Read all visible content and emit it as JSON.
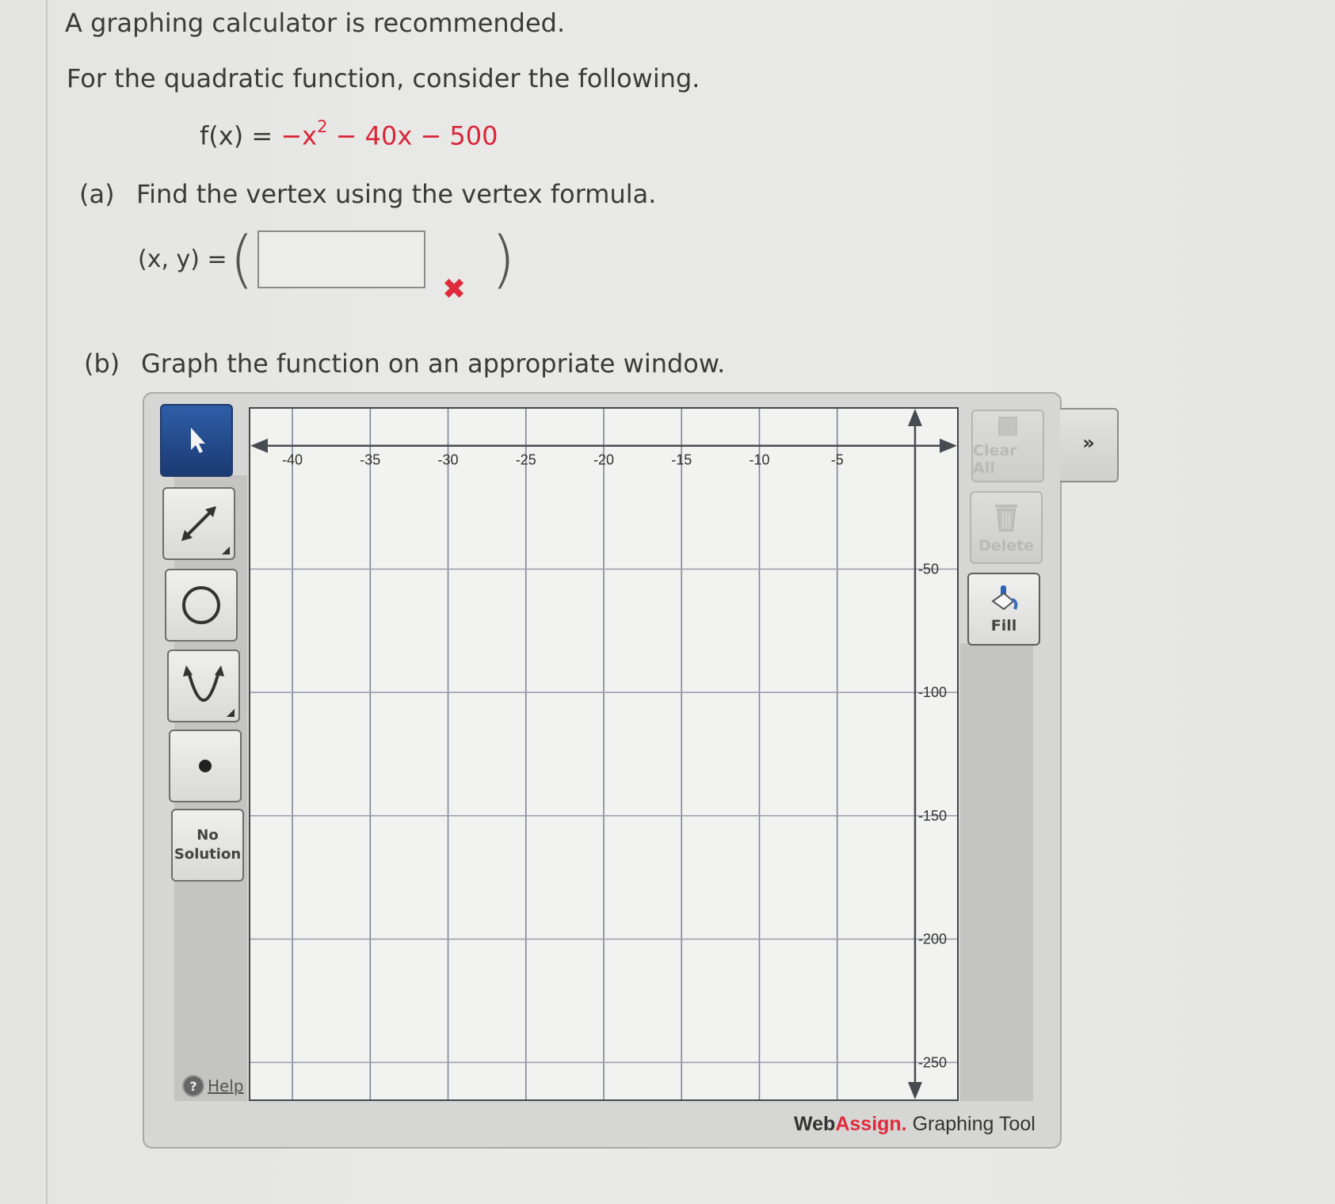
{
  "question": {
    "intro": "A graphing calculator is recommended.",
    "lead": "For the quadratic function, consider the following.",
    "function": {
      "lhs": "f(x) = ",
      "term1": "−x",
      "exp": "2",
      "rest": " − 40x − 500"
    },
    "part_a": {
      "label": "(a)",
      "text": "Find the vertex using the vertex formula.",
      "xy_label": "(x, y) =",
      "paren_left": "(",
      "paren_right": ")",
      "answer_value": "",
      "status_icon": "incorrect-x-icon",
      "status_glyph": "✖",
      "status_color": "#e02b3d"
    },
    "part_b": {
      "label": "(b)",
      "text": "Graph the function on an appropriate window."
    }
  },
  "graph_tool": {
    "left_tools": [
      {
        "name": "select-arrow",
        "icon": "cursor-arrow-icon",
        "active": true
      },
      {
        "name": "line",
        "icon": "double-arrow-line-icon",
        "has_submenu": true
      },
      {
        "name": "circle",
        "icon": "circle-icon"
      },
      {
        "name": "parabola",
        "icon": "parabola-icon",
        "has_submenu": true
      },
      {
        "name": "point",
        "icon": "point-icon"
      },
      {
        "name": "no-solution",
        "label_line1": "No",
        "label_line2": "Solution"
      }
    ],
    "right_tools": [
      {
        "name": "clear-all",
        "label": "Clear All",
        "icon": "clear-all-icon",
        "enabled": false
      },
      {
        "name": "delete",
        "label": "Delete",
        "icon": "trash-icon",
        "enabled": false
      },
      {
        "name": "fill",
        "label": "Fill",
        "icon": "paint-bucket-icon",
        "enabled": true
      }
    ],
    "expand_glyph": "»",
    "help_label": "Help",
    "help_glyph": "?",
    "brand_web": "Web",
    "brand_assign": "Assign.",
    "brand_rest": " Graphing Tool",
    "accent_blue": "#1f4584",
    "brand_red": "#e02b3d"
  },
  "chart_data": {
    "type": "line",
    "title": "",
    "xlabel": "",
    "ylabel": "",
    "xlim": [
      -42.7,
      2.7
    ],
    "ylim": [
      -265,
      15
    ],
    "x_ticks": [
      -40,
      -35,
      -30,
      -25,
      -20,
      -15,
      -10,
      -5
    ],
    "x_tick_labels": [
      "-40",
      "-35",
      "-30",
      "-25",
      "-20",
      "-15",
      "-10",
      "-5"
    ],
    "y_ticks": [
      -50,
      -100,
      -150,
      -200,
      -250
    ],
    "y_tick_labels": [
      "-50",
      "-100",
      "-150",
      "-200",
      "-250"
    ],
    "grid": true,
    "series": []
  }
}
